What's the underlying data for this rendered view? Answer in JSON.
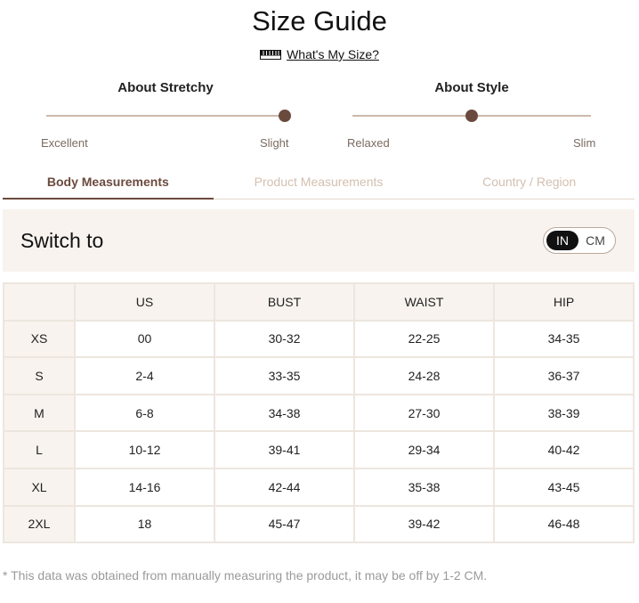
{
  "title": "Size Guide",
  "whats_my_size": {
    "label": "What's My Size?",
    "icon": "ruler-icon"
  },
  "fit": {
    "stretchy": {
      "title": "About Stretchy",
      "left": "Excellent",
      "right": "Slight",
      "level": 1.0
    },
    "style": {
      "title": "About Style",
      "left": "Relaxed",
      "right": "Slim",
      "level": 0.5
    }
  },
  "tabs": [
    {
      "label": "Body Measurements",
      "active": true
    },
    {
      "label": "Product Measurements",
      "active": false
    },
    {
      "label": "Country / Region",
      "active": false
    }
  ],
  "switch": {
    "label": "Switch to",
    "options": [
      "IN",
      "CM"
    ],
    "selected": "IN"
  },
  "table": {
    "headers": [
      "",
      "US",
      "BUST",
      "WAIST",
      "HIP"
    ],
    "rows": [
      [
        "XS",
        "00",
        "30-32",
        "22-25",
        "34-35"
      ],
      [
        "S",
        "2-4",
        "33-35",
        "24-28",
        "36-37"
      ],
      [
        "M",
        "6-8",
        "34-38",
        "27-30",
        "38-39"
      ],
      [
        "L",
        "10-12",
        "39-41",
        "29-34",
        "40-42"
      ],
      [
        "XL",
        "14-16",
        "42-44",
        "35-38",
        "43-45"
      ],
      [
        "2XL",
        "18",
        "45-47",
        "39-42",
        "46-48"
      ]
    ]
  },
  "note": "* This data was obtained from manually measuring the product, it may be off by 1-2 CM.",
  "colors": {
    "accent": "#6b4a3e",
    "panel": "#f8f3ee",
    "inactive_tab": "#d3bfaf"
  }
}
